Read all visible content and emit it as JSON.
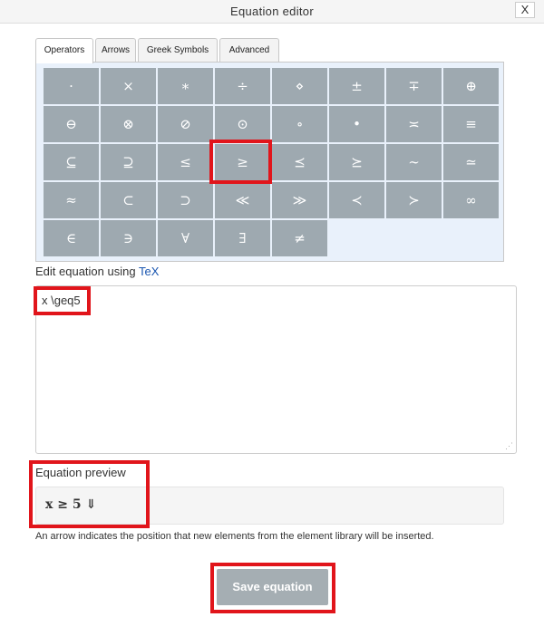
{
  "window": {
    "title": "Equation editor",
    "close_label": "X"
  },
  "tabs": [
    {
      "label": "Operators",
      "active": true
    },
    {
      "label": "Arrows",
      "active": false
    },
    {
      "label": "Greek Symbols",
      "active": false
    },
    {
      "label": "Advanced",
      "active": false
    }
  ],
  "palette": {
    "rows": [
      [
        "·",
        "×",
        "∗",
        "÷",
        "⋄",
        "±",
        "∓",
        "⊕"
      ],
      [
        "⊖",
        "⊗",
        "⊘",
        "⊙",
        "∘",
        "•",
        "≍",
        "≡"
      ],
      [
        "⊆",
        "⊇",
        "≤",
        "≥",
        "⪯",
        "⪰",
        "∼",
        "≃"
      ],
      [
        "≈",
        "⊂",
        "⊃",
        "≪",
        "≫",
        "≺",
        "≻",
        "∞"
      ],
      [
        "∈",
        "∋",
        "∀",
        "∃",
        "≠"
      ]
    ]
  },
  "editor": {
    "label_prefix": "Edit equation using ",
    "label_link": "TeX",
    "value": "x \\geq5"
  },
  "preview": {
    "label": "Equation preview",
    "content": "x ≥ 5 ⇓",
    "help_text": "An arrow indicates the position that new elements from the element library will be inserted."
  },
  "actions": {
    "save_label": "Save equation"
  },
  "colors": {
    "symbol_bg": "#9ea9b0",
    "palette_bg": "#e9f1fb",
    "highlight": "#e1151b",
    "link": "#1a56b0",
    "save_bg": "#a5aeb3"
  }
}
